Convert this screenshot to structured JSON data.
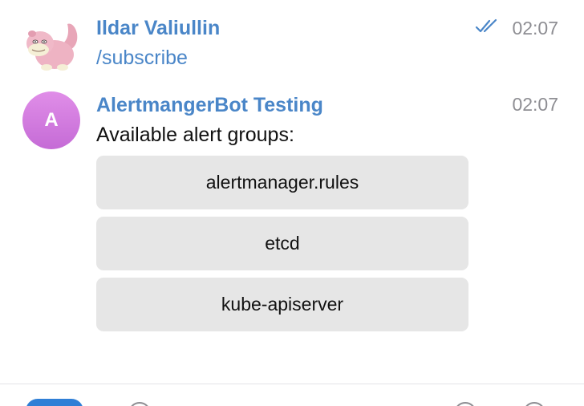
{
  "messages": [
    {
      "sender": "Ildar Valiullin",
      "text": "/subscribe",
      "time": "02:07",
      "status_icon": "double-check-read-icon",
      "avatar_icon": "slowpoke-avatar"
    },
    {
      "sender": "AlertmangerBot Testing",
      "avatar_letter": "A",
      "text": "Available alert groups:",
      "time": "02:07",
      "buttons": [
        "alertmanager.rules",
        "etcd",
        "kube-apiserver"
      ]
    }
  ],
  "colors": {
    "sender_name": "#4a86c8",
    "link": "#4a86c8",
    "time": "#8e8e93",
    "keyboard_button_bg": "#e6e6e6",
    "bot_avatar_gradient": [
      "#e08ee8",
      "#c56bd6"
    ],
    "accent": "#2f7fd6"
  }
}
